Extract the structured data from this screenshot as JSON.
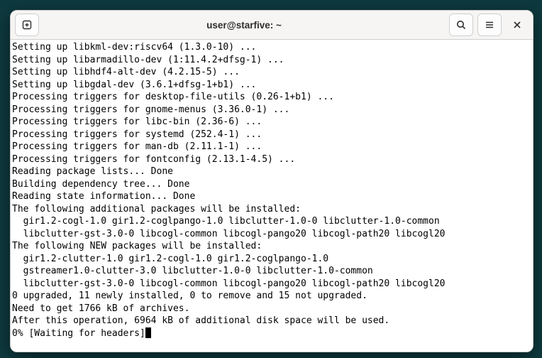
{
  "window": {
    "title": "user@starfive: ~"
  },
  "icons": {
    "newtab": "plus-square",
    "search": "search",
    "menu": "hamburger",
    "close": "close"
  },
  "terminal": {
    "lines": [
      "Setting up libkml-dev:riscv64 (1.3.0-10) ...",
      "Setting up libarmadillo-dev (1:11.4.2+dfsg-1) ...",
      "Setting up libhdf4-alt-dev (4.2.15-5) ...",
      "Setting up libgdal-dev (3.6.1+dfsg-1+b1) ...",
      "Processing triggers for desktop-file-utils (0.26-1+b1) ...",
      "Processing triggers for gnome-menus (3.36.0-1) ...",
      "Processing triggers for libc-bin (2.36-6) ...",
      "Processing triggers for systemd (252.4-1) ...",
      "Processing triggers for man-db (2.11.1-1) ...",
      "Processing triggers for fontconfig (2.13.1-4.5) ...",
      "Reading package lists... Done",
      "Building dependency tree... Done",
      "Reading state information... Done",
      "The following additional packages will be installed:",
      "  gir1.2-cogl-1.0 gir1.2-coglpango-1.0 libclutter-1.0-0 libclutter-1.0-common",
      "  libclutter-gst-3.0-0 libcogl-common libcogl-pango20 libcogl-path20 libcogl20",
      "The following NEW packages will be installed:",
      "  gir1.2-clutter-1.0 gir1.2-cogl-1.0 gir1.2-coglpango-1.0",
      "  gstreamer1.0-clutter-3.0 libclutter-1.0-0 libclutter-1.0-common",
      "  libclutter-gst-3.0-0 libcogl-common libcogl-pango20 libcogl-path20 libcogl20",
      "0 upgraded, 11 newly installed, 0 to remove and 15 not upgraded.",
      "Need to get 1766 kB of archives.",
      "After this operation, 6964 kB of additional disk space will be used."
    ],
    "last_line": "0% [Waiting for headers]"
  }
}
